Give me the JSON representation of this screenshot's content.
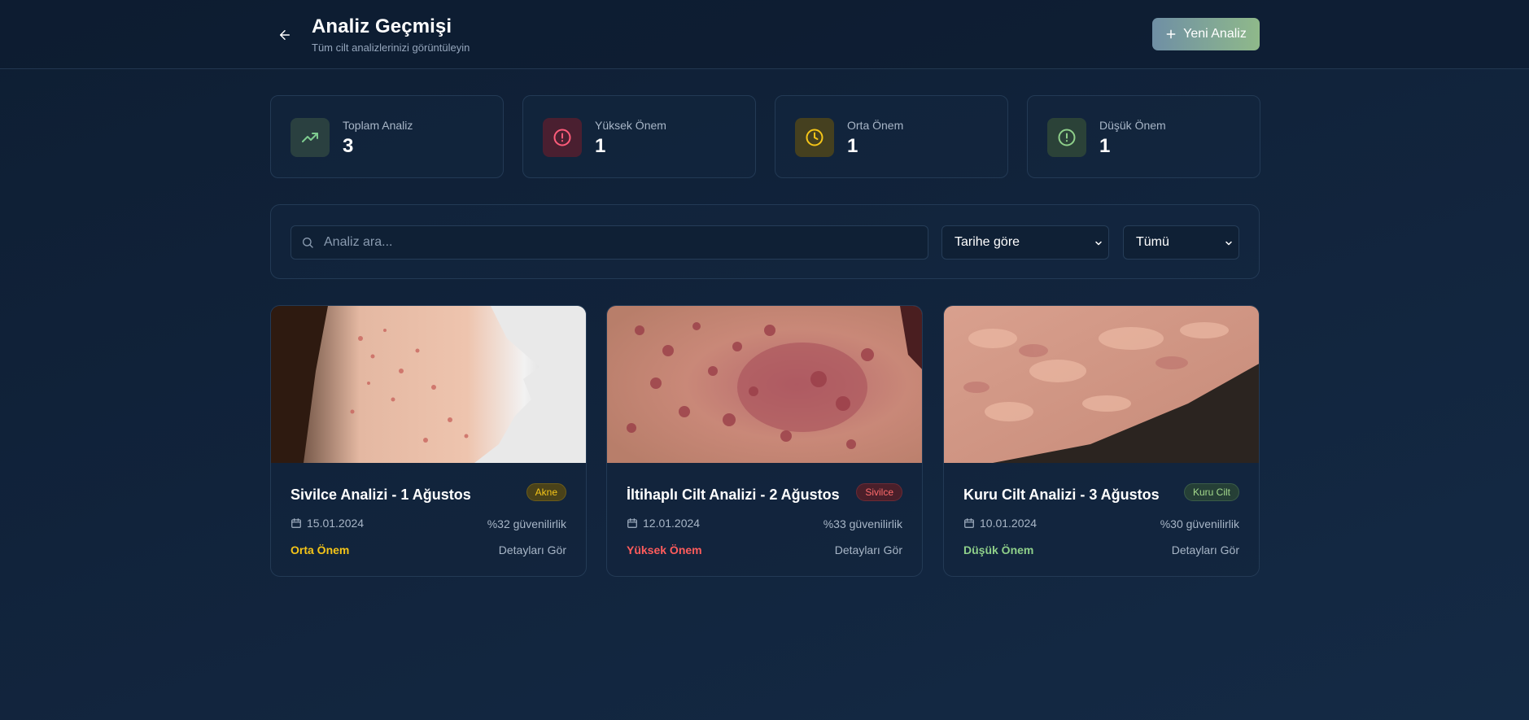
{
  "header": {
    "title": "Analiz Geçmişi",
    "subtitle": "Tüm cilt analizlerinizi görüntüleyin",
    "new_button_label": "Yeni Analiz",
    "back_icon": "arrow-left-icon"
  },
  "stats": [
    {
      "label": "Toplam Analiz",
      "value": "3",
      "icon": "trending-up-icon",
      "color": "#7ecb8f"
    },
    {
      "label": "Yüksek Önem",
      "value": "1",
      "icon": "alert-circle-icon",
      "color": "#ff5c7a"
    },
    {
      "label": "Orta Önem",
      "value": "1",
      "icon": "clock-icon",
      "color": "#f5c518"
    },
    {
      "label": "Düşük Önem",
      "value": "1",
      "icon": "alert-circle-icon",
      "color": "#8fd08a"
    }
  ],
  "filters": {
    "search_placeholder": "Analiz ara...",
    "sort_value": "Tarihe göre",
    "type_value": "Tümü"
  },
  "cards": [
    {
      "title": "Sivilce Analizi - 1 Ağustos",
      "badge": "Akne",
      "date": "15.01.2024",
      "confidence": "%32 güvenilirlik",
      "severity": "Orta Önem",
      "severity_color": "#f5c518",
      "detail_label": "Detayları Gör"
    },
    {
      "title": "İltihaplı Cilt Analizi - 2 Ağustos",
      "badge": "Sivilce",
      "date": "12.01.2024",
      "confidence": "%33 güvenilirlik",
      "severity": "Yüksek Önem",
      "severity_color": "#ff5c5c",
      "detail_label": "Detayları Gör"
    },
    {
      "title": "Kuru Cilt Analizi - 3 Ağustos",
      "badge": "Kuru Cilt",
      "date": "10.01.2024",
      "confidence": "%30 güvenilirlik",
      "severity": "Düşük Önem",
      "severity_color": "#8fd08a",
      "detail_label": "Detayları Gör"
    }
  ],
  "colors": {
    "accent_start": "#6f8fa5",
    "accent_end": "#8fb98a",
    "background": "#11233b"
  }
}
